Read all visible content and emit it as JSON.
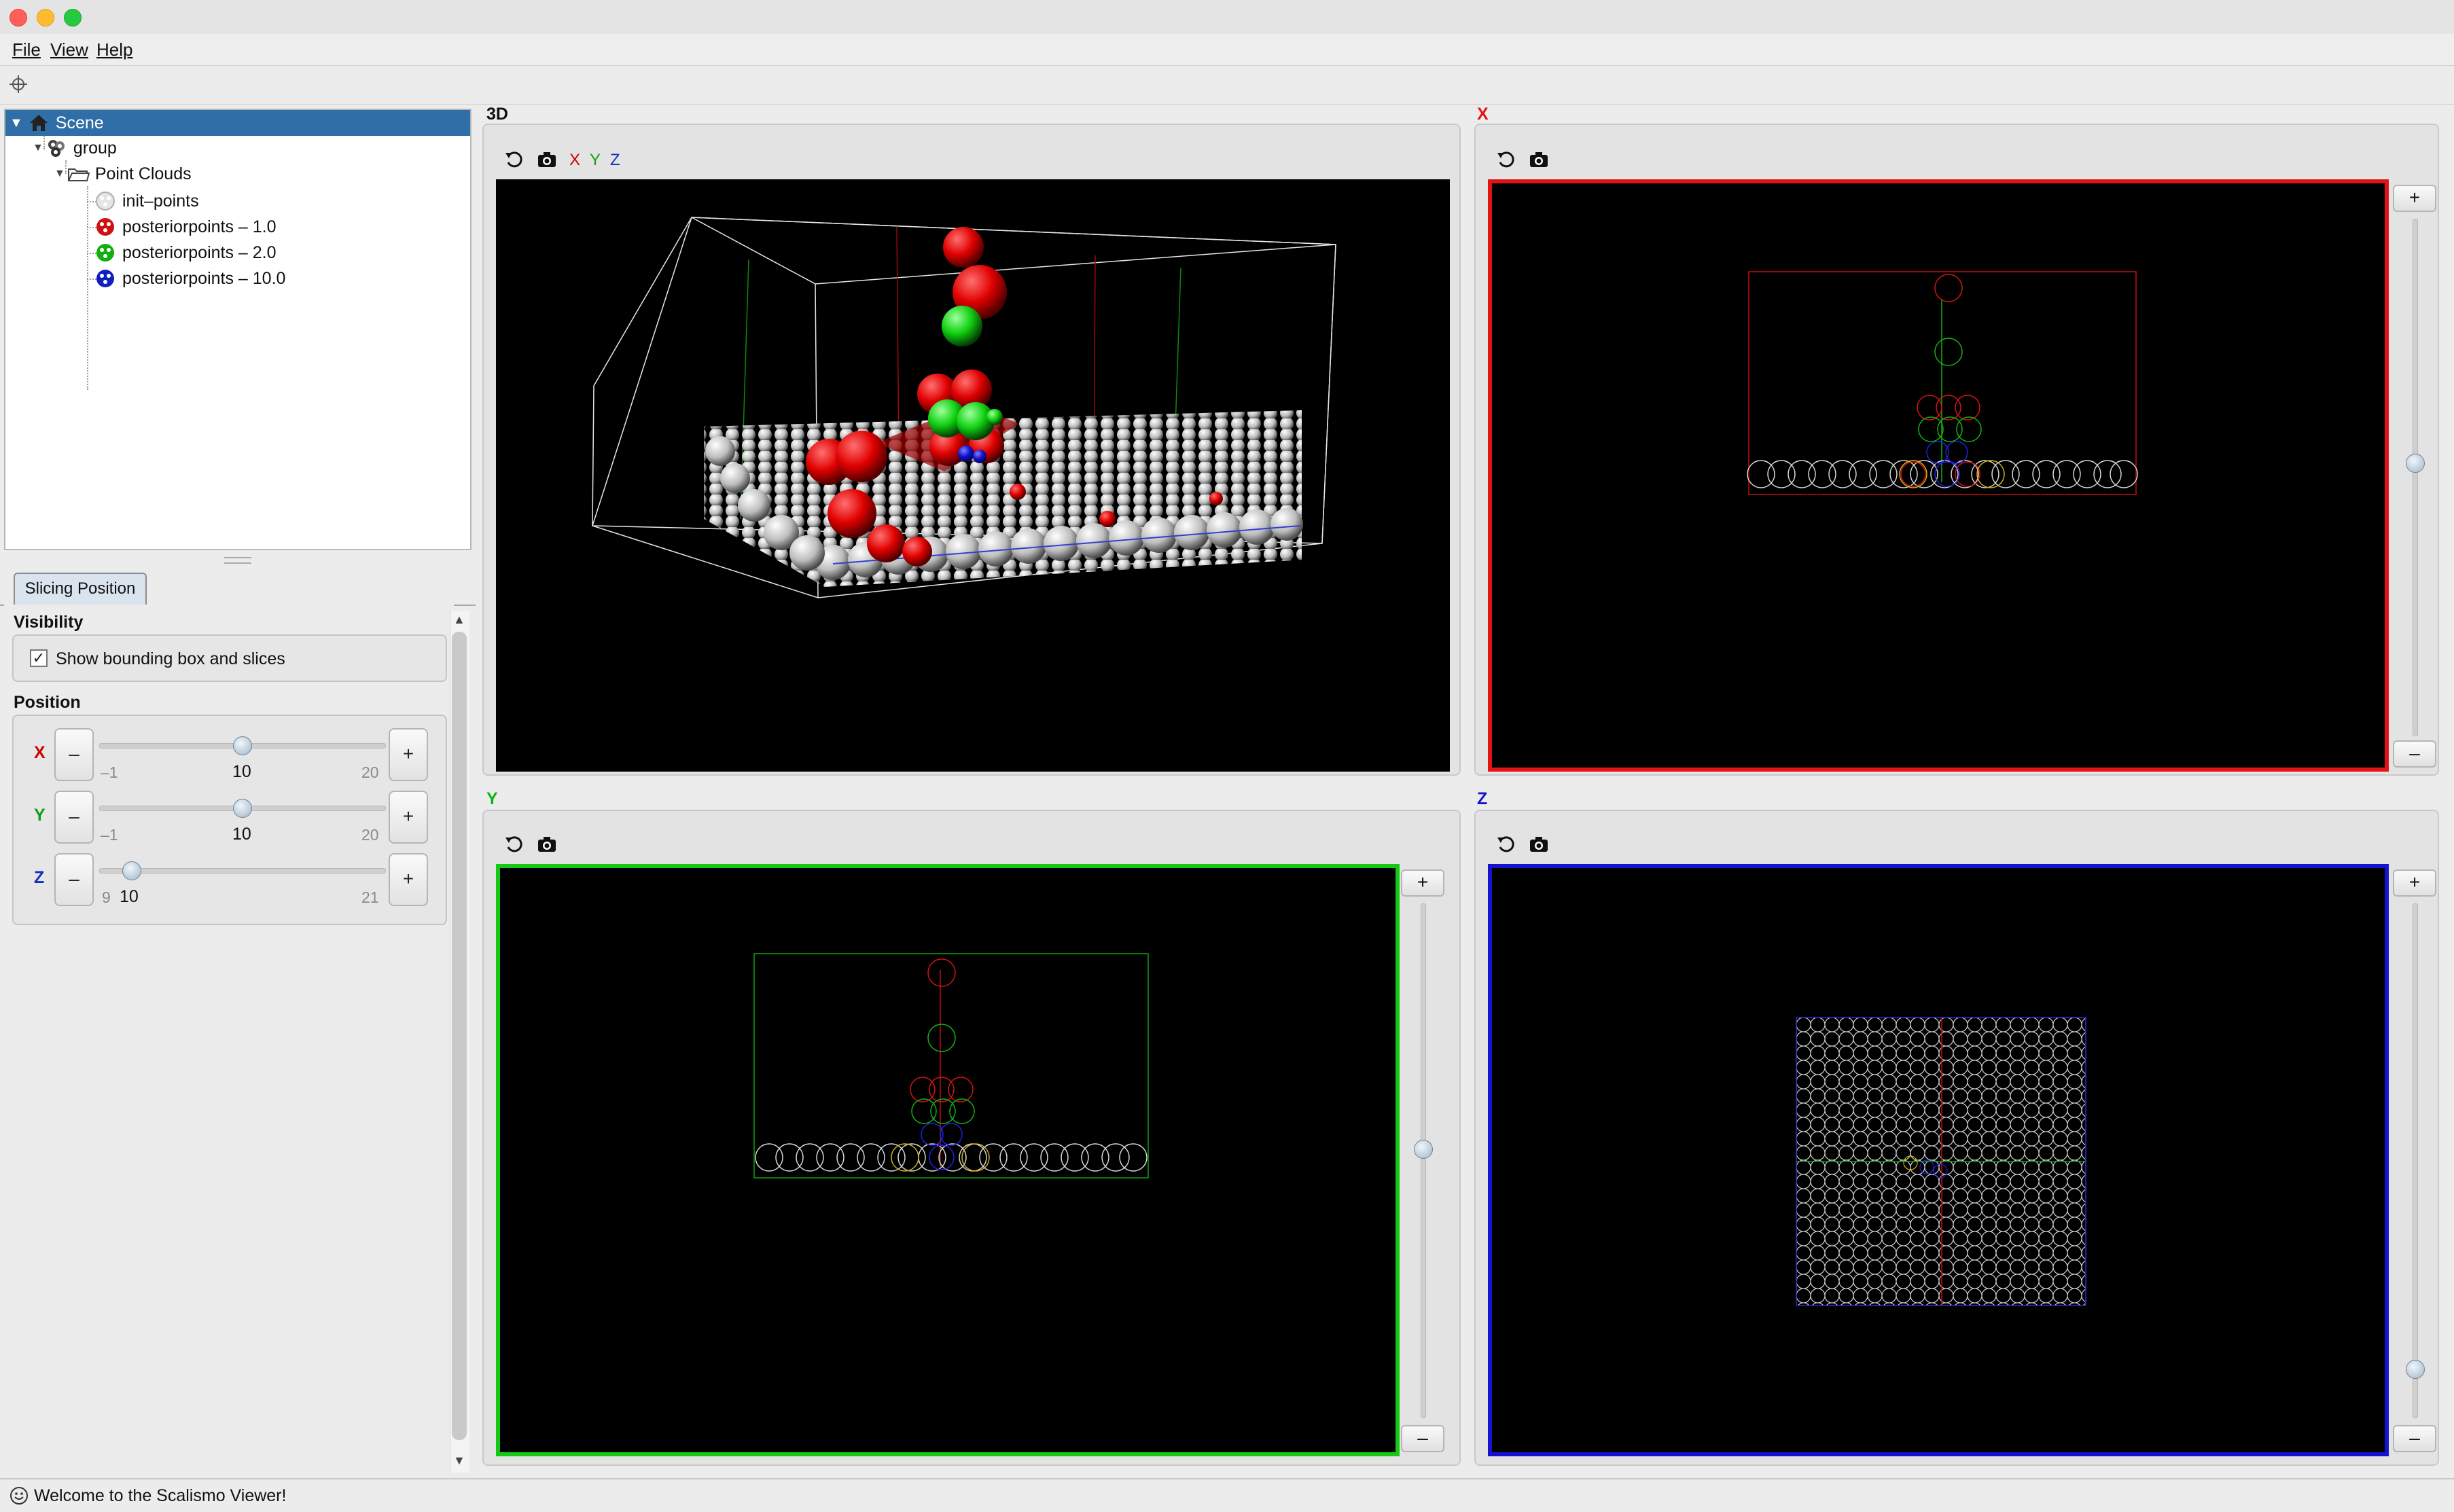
{
  "menu": {
    "file": "File",
    "view": "View",
    "help": "Help"
  },
  "tree": {
    "scene": "Scene",
    "group": "group",
    "point_clouds": "Point Clouds",
    "items": [
      "init–points",
      "posteriorpoints – 1.0",
      "posteriorpoints – 2.0",
      "posteriorpoints – 10.0"
    ],
    "item_colors": [
      "#d8d8d8",
      "#d01010",
      "#10b010",
      "#1020c0"
    ]
  },
  "tab": {
    "label": "Slicing Position"
  },
  "visibility": {
    "title": "Visibility",
    "checkbox_label": "Show bounding box and slices",
    "checked": true
  },
  "position": {
    "title": "Position",
    "rows": [
      {
        "axis": "X",
        "color": "#d00000",
        "min": "–1",
        "max": "20",
        "value": "10",
        "fraction": 0.5
      },
      {
        "axis": "Y",
        "color": "#12a012",
        "min": "–1",
        "max": "20",
        "value": "10",
        "fraction": 0.5
      },
      {
        "axis": "Z",
        "color": "#1030c0",
        "min": "9",
        "max": "21",
        "value": "10",
        "fraction": 0.083
      }
    ],
    "minus": "–",
    "plus": "+"
  },
  "views": {
    "v3d": {
      "label": "3D",
      "axes": [
        "X",
        "Y",
        "Z"
      ]
    },
    "x": {
      "label": "X",
      "color": "#e01414",
      "slider_fraction": 0.5
    },
    "y": {
      "label": "Y",
      "color": "#14c814",
      "slider_fraction": 0.5
    },
    "z": {
      "label": "Z",
      "color": "#1414d0",
      "slider_fraction": 0.92
    },
    "plus": "+",
    "minus": "–"
  },
  "status": {
    "text": "Welcome to the Scalismo Viewer!"
  }
}
